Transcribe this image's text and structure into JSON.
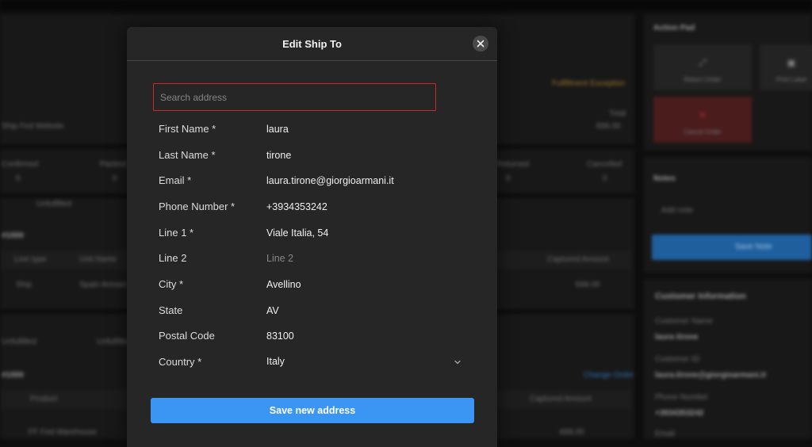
{
  "background": {
    "action_panel_title": "Action Pad",
    "tiles": [
      "Return Order",
      "Print Label",
      "Cancel Order"
    ],
    "notes_title": "Notes",
    "notes_placeholder": "Add note",
    "save_note_label": "Save Note",
    "customer_title": "Customer Information",
    "customer_fields": [
      {
        "label": "Customer Name",
        "value": "laura tirone"
      },
      {
        "label": "Customer ID",
        "value": "laura.tirone@giorgioarmani.it"
      },
      {
        "label": "Phone Number",
        "value": "+3934353242"
      },
      {
        "label": "Email",
        "value": ""
      }
    ],
    "status_badge": "Fulfillment Exception",
    "order_source": "Ship Fed Website",
    "total_label": "Total",
    "total_value": "€88.00",
    "status_columns": [
      {
        "label": "Confirmed",
        "value": "0"
      },
      {
        "label": "Packed",
        "value": "0"
      },
      {
        "label": "Returned",
        "value": "0"
      },
      {
        "label": "Cancelled",
        "value": "0"
      }
    ],
    "section_tag": "Unfulfilled",
    "order_ref_1": "#1000",
    "table_headers": [
      "Line type",
      "Unit Name",
      "Captured Amount"
    ],
    "table_row": [
      "Ship",
      "Spain Armani",
      "€88.00"
    ],
    "section_2_a": "Unfulfilled",
    "section_2_b": "Unfulfilled",
    "order_ref_2": "#1000",
    "change_link": "Change Order",
    "table2_headers": [
      "Product",
      "Captured Amount"
    ],
    "table2_row": [
      "FF Fed Warehouse",
      "€88.00"
    ]
  },
  "modal": {
    "title": "Edit Ship To",
    "search": {
      "placeholder": "Search address",
      "value": ""
    },
    "fields": [
      {
        "label": "First Name *",
        "value": "laura",
        "placeholder": "First Name"
      },
      {
        "label": "Last Name *",
        "value": "tirone",
        "placeholder": "Last Name"
      },
      {
        "label": "Email *",
        "value": "laura.tirone@giorgioarmani.it",
        "placeholder": "Email"
      },
      {
        "label": "Phone Number *",
        "value": "+3934353242",
        "placeholder": "Phone Number"
      },
      {
        "label": "Line 1 *",
        "value": "Viale Italia, 54",
        "placeholder": "Line 1"
      },
      {
        "label": "Line 2",
        "value": "",
        "placeholder": "Line 2"
      },
      {
        "label": "City *",
        "value": "Avellino",
        "placeholder": "City"
      },
      {
        "label": "State",
        "value": "AV",
        "placeholder": "State"
      },
      {
        "label": "Postal Code",
        "value": "83100",
        "placeholder": "Postal Code"
      }
    ],
    "country": {
      "label": "Country *",
      "value": "Italy"
    },
    "save_label": "Save new address"
  },
  "icons": {
    "close": "close-icon",
    "chevron": "chevron-down-icon"
  },
  "colors": {
    "accent": "#3b95f3",
    "error_border": "#c42b2b",
    "modal_bg": "#262626"
  }
}
